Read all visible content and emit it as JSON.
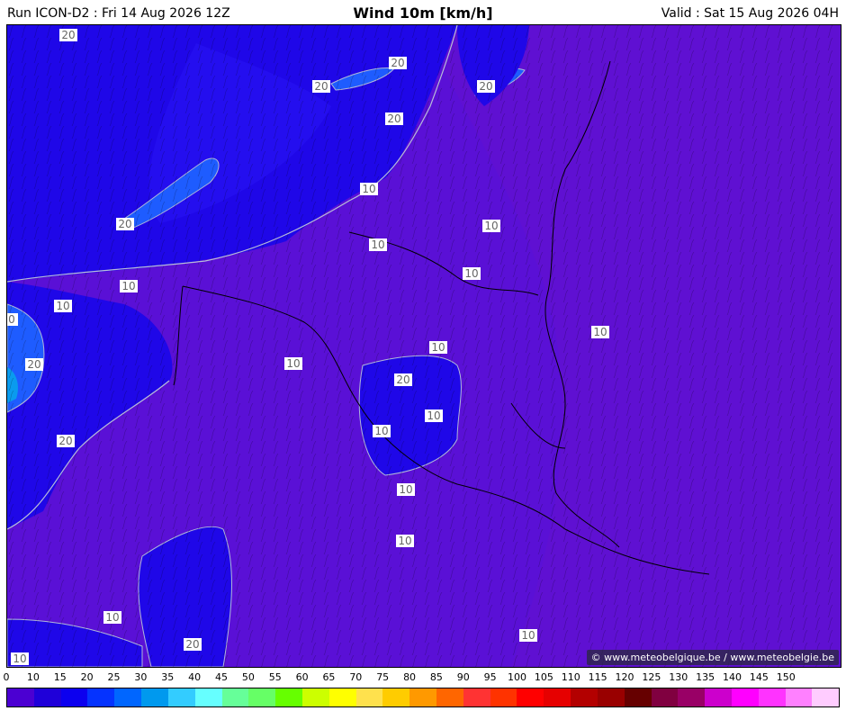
{
  "header": {
    "run": "Run ICON-D2 : Fri 14 Aug 2026 12Z",
    "title": "Wind 10m [km/h]",
    "valid": "Valid : Sat 15 Aug 2026 04H"
  },
  "map": {
    "credit": "© www.meteobelgique.be / www.meteobelgie.be",
    "contour_labels": [
      "20",
      "20",
      "20",
      "20",
      "20",
      "10",
      "10",
      "10",
      "10",
      "10",
      "20",
      "10",
      "10",
      "0",
      "20",
      "10",
      "10",
      "20",
      "20",
      "10",
      "10",
      "10",
      "10",
      "10",
      "10",
      "20",
      "10"
    ]
  },
  "legend": {
    "labels": [
      "0",
      "10",
      "15",
      "20",
      "25",
      "30",
      "35",
      "40",
      "45",
      "50",
      "55",
      "60",
      "65",
      "70",
      "75",
      "80",
      "85",
      "90",
      "95",
      "100",
      "105",
      "110",
      "115",
      "120",
      "125",
      "130",
      "135",
      "140",
      "145",
      "150"
    ],
    "colors": [
      "#4b00d2",
      "#1f00d9",
      "#0c00ef",
      "#0533ff",
      "#0066ff",
      "#0099ee",
      "#33ccff",
      "#66ffff",
      "#66ff99",
      "#66ff66",
      "#66ff00",
      "#ccff00",
      "#ffff00",
      "#ffe14d",
      "#ffcc00",
      "#ff9900",
      "#ff6600",
      "#ff3333",
      "#ff3300",
      "#ff0000",
      "#e60000",
      "#b30000",
      "#990000",
      "#660000",
      "#800040",
      "#990066",
      "#cc00cc",
      "#ff00ff",
      "#ff33ff",
      "#ff80ff",
      "#ffccff"
    ]
  }
}
